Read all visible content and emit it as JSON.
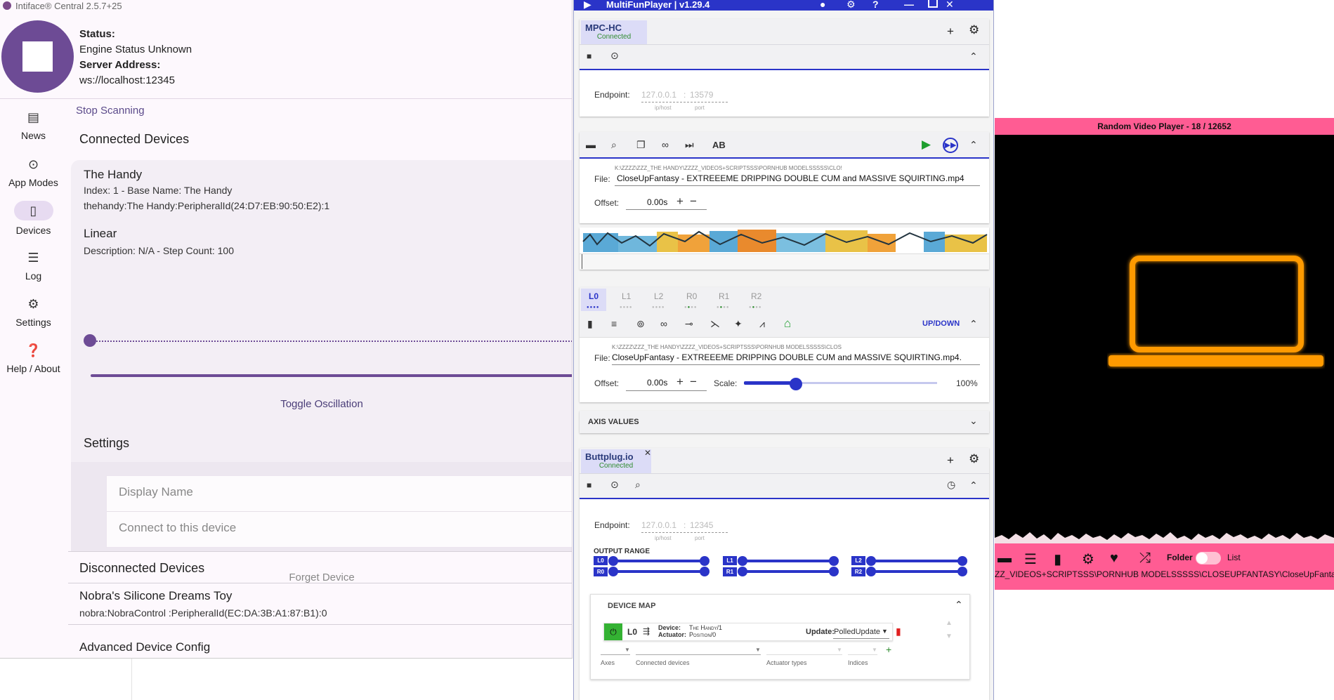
{
  "intiface": {
    "title": "Intiface® Central 2.5.7+25",
    "status_label": "Status:",
    "status_value": "Engine Status Unknown",
    "server_label": "Server Address:",
    "server_value": "ws://localhost:12345",
    "nav": [
      {
        "label": "News",
        "icon": "news-icon"
      },
      {
        "label": "App Modes",
        "icon": "play-circle-icon"
      },
      {
        "label": "Devices",
        "icon": "vibrate-icon"
      },
      {
        "label": "Log",
        "icon": "document-icon"
      },
      {
        "label": "Settings",
        "icon": "gear-icon"
      },
      {
        "label": "Help / About",
        "icon": "help-icon"
      }
    ],
    "stop_scanning": "Stop Scanning",
    "connected_devices": "Connected Devices",
    "device": {
      "name": "The Handy",
      "index_line": "Index: 1 - Base Name: The Handy",
      "id_line": "thehandy:The Handy:PeripheralId(24:D7:EB:90:50:E2):1",
      "actuator": "Linear",
      "actuator_desc": "Description: N/A - Step Count: 100",
      "toggle_oscillation": "Toggle Oscillation",
      "settings_title": "Settings",
      "display_name_placeholder": "Display Name",
      "connect_placeholder": "Connect to this device",
      "forget": "Forget Device"
    },
    "disconnected_devices": "Disconnected Devices",
    "disconnected": {
      "name": "Nobra's Silicone Dreams Toy",
      "id_line": "nobra:NobraControl  :PeripheralId(EC:DA:3B:A1:87:B1):0"
    },
    "advanced": "Advanced Device Config"
  },
  "mfp": {
    "title": "MultiFunPlayer  |  v1.29.4",
    "media": {
      "tab_name": "MPC-HC",
      "tab_status": "Connected",
      "endpoint_label": "Endpoint:",
      "endpoint_host": "127.0.0.1",
      "endpoint_port": "13579",
      "host_hint": "ip/host",
      "port_hint": "port"
    },
    "script": {
      "ab_label": "AB",
      "file_label": "File:",
      "file_path": "K:\\ZZZZ\\ZZZ_THE HANDY\\ZZZZ_VIDEOS+SCRIPTSSS\\PORNHUB MODELSSSSS\\CLO!",
      "file_name": "CloseUpFantasy - EXTREEEME DRIPPING DOUBLE CUM and MASSIVE SQUIRTING.mp4",
      "offset_label": "Offset:",
      "offset_value": "0.00s"
    },
    "axes": {
      "tabs": [
        "L0",
        "L1",
        "L2",
        "R0",
        "R1",
        "R2"
      ],
      "mode": "UP/DOWN",
      "file_label": "File:",
      "file_path": "K:\\ZZZZ\\ZZZ_THE HANDY\\ZZZZ_VIDEOS+SCRIPTSSS\\PORNHUB MODELSSSSS\\CLOS",
      "file_name": "CloseUpFantasy - EXTREEEME DRIPPING DOUBLE CUM and MASSIVE SQUIRTING.mp4.",
      "offset_label": "Offset:",
      "offset_value": "0.00s",
      "scale_label": "Scale:",
      "scale_value": "100%",
      "scale_fraction": 0.27
    },
    "axis_values": "AXIS VALUES",
    "output": {
      "tab_name": "Buttplug.io",
      "tab_status": "Connected",
      "endpoint_label": "Endpoint:",
      "endpoint_host": "127.0.0.1",
      "endpoint_port": "12345",
      "host_hint": "ip/host",
      "port_hint": "port",
      "output_range": "OUTPUT RANGE",
      "range_badges": [
        [
          "L0",
          "R0"
        ],
        [
          "L1",
          "R1"
        ],
        [
          "L2",
          "R2"
        ]
      ],
      "device_map": "DEVICE MAP",
      "map_axis": "L0",
      "device_label": "Device:",
      "device_value": "The Handy/1",
      "actuator_label": "Actuator:",
      "actuator_value": "Position/0",
      "update_label": "Update:",
      "update_value": "PolledUpdate",
      "col_axes": "Axes",
      "col_devices": "Connected devices",
      "col_actuators": "Actuator types",
      "col_indices": "Indices"
    }
  },
  "rvp": {
    "title": "Random Video Player - 18 / 12652",
    "folder_label": "Folder",
    "list_label": "List",
    "path": "ZZ_VIDEOS+SCRIPTSSS\\PORNHUB MODELSSSSS\\CLOSEUPFANTASY\\CloseUpFantasy - EX",
    "toggle_on": false
  },
  "colors": {
    "intiface_accent": "#6d4b95",
    "mfp_accent": "#2a34c8",
    "rvp_accent": "#ff5c93",
    "laptop_glow": "#ff9a00"
  }
}
